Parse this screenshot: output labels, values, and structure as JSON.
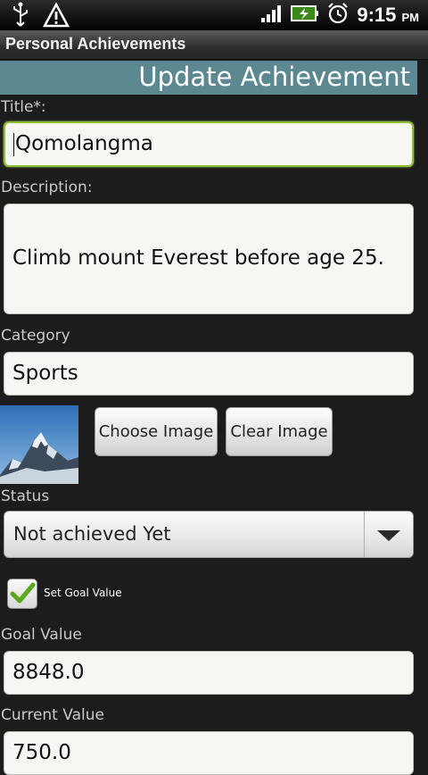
{
  "status_bar": {
    "time": "9:15",
    "ampm": "PM",
    "icons": [
      "usb-icon",
      "warning-icon",
      "signal-icon",
      "battery-charging-icon",
      "alarm-icon"
    ]
  },
  "app": {
    "title": "Personal Achievements"
  },
  "screen": {
    "heading": "Update Achievement"
  },
  "form": {
    "title_label": "Title*:",
    "title_value": "Qomolangma",
    "description_label": "Description:",
    "description_value": "Climb mount Everest before age 25.",
    "category_label": "Category",
    "category_value": "Sports",
    "choose_image_label": "Choose Image",
    "clear_image_label": "Clear Image",
    "status_label": "Status",
    "status_value": "Not achieved Yet",
    "set_goal_label": "Set Goal Value",
    "set_goal_checked": true,
    "goal_label": "Goal Value",
    "goal_value": "8848.0",
    "current_label": "Current Value",
    "current_value": "750.0"
  },
  "colors": {
    "header_bg": "#5b8891",
    "focus_border": "#8fbf3a",
    "check": "#5aa81c"
  }
}
